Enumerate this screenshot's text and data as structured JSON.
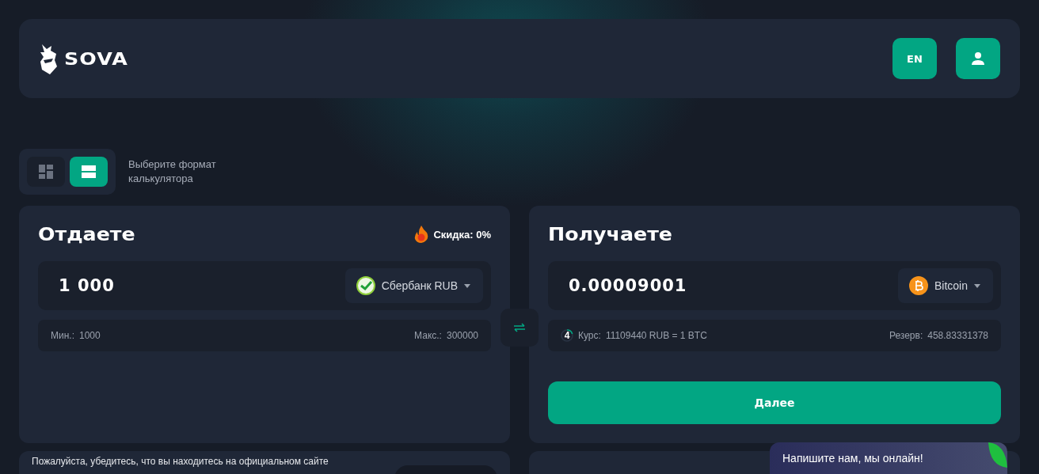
{
  "header": {
    "logo": "SOVA",
    "language": "EN"
  },
  "format": {
    "hint": "Выберите формат калькулятора",
    "options": [
      {
        "kind": "grid",
        "selected": false
      },
      {
        "kind": "rows",
        "selected": true
      }
    ]
  },
  "give": {
    "title": "Отдаете",
    "discount": "Скидка: 0%",
    "amount": "1 000",
    "currency": {
      "name": "Сбербанк RUB",
      "kind": "sber"
    },
    "min_label": "Мин.:",
    "min": "1000",
    "max_label": "Макс.:",
    "max": "300000"
  },
  "get": {
    "title": "Получаете",
    "amount": "0.00009001",
    "currency": {
      "name": "Bitcoin",
      "kind": "btc"
    },
    "timer": {
      "text": "4",
      "level": 0.2
    },
    "rate_label": "Курс:",
    "rate": "11109440 RUB = 1 BTC",
    "reserve_label": "Резерв:",
    "reserve": "458.83331378",
    "button": "Далее"
  },
  "notice": "Пожалуйста, убедитесь, что вы находитесь на официальном сайте",
  "chat": "Напишите нам, мы онлайн!"
}
